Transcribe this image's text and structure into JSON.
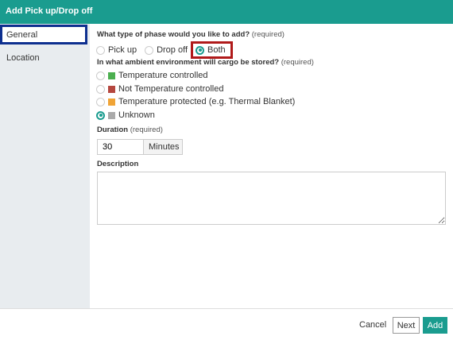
{
  "title": "Add Pick up/Drop off",
  "sidebar": {
    "items": [
      {
        "label": "General"
      },
      {
        "label": "Location"
      }
    ]
  },
  "phase": {
    "question": "What type of phase would you like to add?",
    "required": "(required)",
    "options": [
      {
        "label": "Pick up",
        "selected": false
      },
      {
        "label": "Drop off",
        "selected": false
      },
      {
        "label": "Both",
        "selected": true
      }
    ]
  },
  "environment": {
    "question": "In what ambient environment will cargo be stored?",
    "required": "(required)",
    "options": [
      {
        "label": "Temperature controlled",
        "color": "#4caf50",
        "selected": false
      },
      {
        "label": "Not Temperature controlled",
        "color": "#b5473f",
        "selected": false
      },
      {
        "label": "Temperature protected (e.g. Thermal Blanket)",
        "color": "#f0a436",
        "selected": false
      },
      {
        "label": "Unknown",
        "color": "#aaaaaa",
        "selected": true
      }
    ]
  },
  "duration": {
    "label": "Duration",
    "required": "(required)",
    "value": "30",
    "unit": "Minutes"
  },
  "description": {
    "label": "Description",
    "value": ""
  },
  "footer": {
    "cancel_label": "Cancel",
    "next_label": "Next",
    "add_label": "Add"
  }
}
